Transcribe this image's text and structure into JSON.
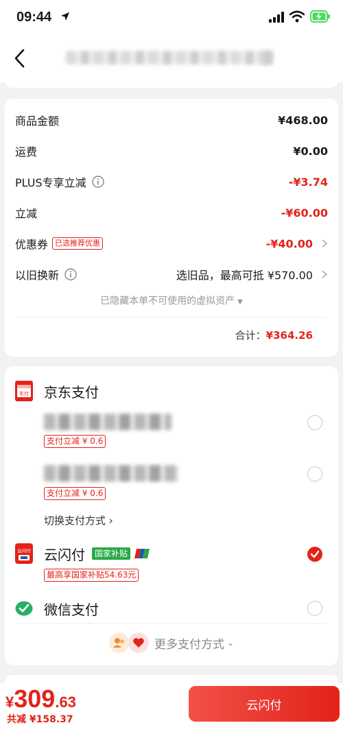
{
  "status_bar": {
    "time": "09:44"
  },
  "summary": {
    "rows": [
      {
        "label": "商品金额",
        "value": "¥468.00"
      },
      {
        "label": "运费",
        "value": "¥0.00"
      },
      {
        "label": "PLUS专享立减",
        "value": "-¥3.74"
      },
      {
        "label": "立减",
        "value": "-¥60.00"
      },
      {
        "label": "优惠券",
        "tag": "已选推荐优惠",
        "value": "-¥40.00"
      },
      {
        "label": "以旧换新",
        "value": "选旧品，最高可抵 ¥570.00"
      }
    ],
    "hidden_note": "已隐藏本单不可使用的虚拟资产",
    "total_label": "合计：",
    "total_value": "¥364.26"
  },
  "payment": {
    "jd_pay": {
      "title": "京东支付",
      "cards": [
        {
          "discount": "支付立减 ¥ 0.6"
        },
        {
          "discount": "支付立减 ¥ 0.6"
        }
      ],
      "switch_label": "切换支付方式"
    },
    "methods": [
      {
        "name": "云闪付",
        "tag": "国家补贴",
        "subsidy": "最高享国家补贴54.63元",
        "selected": true
      },
      {
        "name": "微信支付",
        "selected": false
      }
    ],
    "more_label": "更多支付方式"
  },
  "footer": {
    "price_currency": "¥",
    "price_integer": "309",
    "price_decimal": ".63",
    "saving": "共减 ¥158.37",
    "pay_button": "云闪付"
  },
  "colors": {
    "accent": "#e2231a",
    "gov_green": "#2aa846",
    "wechat_green": "#2aae67"
  }
}
